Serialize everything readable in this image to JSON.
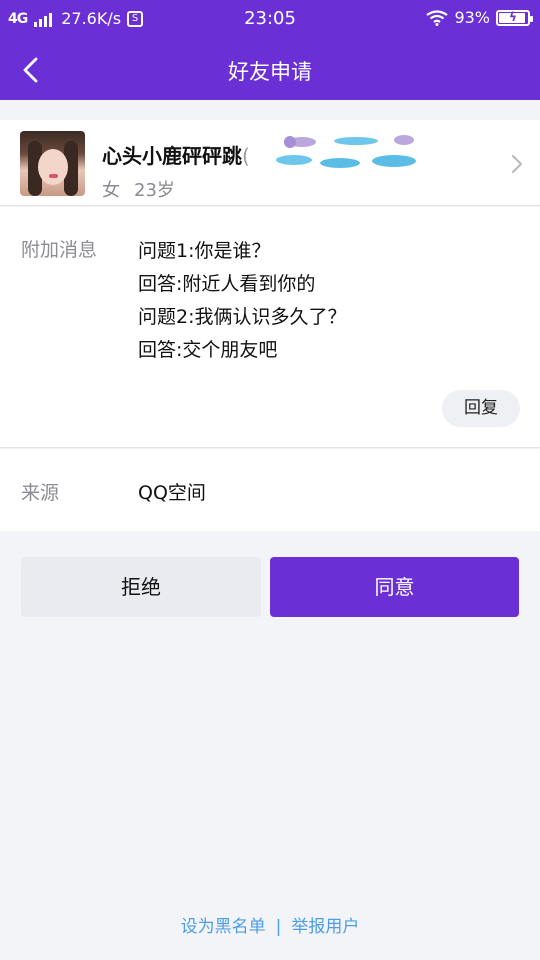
{
  "status_bar": {
    "network": "4G",
    "speed": "27.6K/s",
    "time": "23:05",
    "battery_percent": "93%",
    "battery_level": 0.93
  },
  "nav": {
    "title": "好友申请"
  },
  "profile": {
    "nickname": "心头小鹿砰砰跳",
    "paren": "(",
    "gender": "女",
    "age": "23岁"
  },
  "message": {
    "label": "附加消息",
    "lines": [
      "问题1:你是谁？",
      "回答:附近人看到你的",
      "问题2:我俩认识多久了？",
      "回答:交个朋友吧"
    ],
    "reply_label": "回复"
  },
  "source": {
    "label": "来源",
    "value": "QQ空间"
  },
  "actions": {
    "reject_label": "拒绝",
    "accept_label": "同意"
  },
  "footer": {
    "blacklist_label": "设为黑名单",
    "separator": "|",
    "report_label": "举报用户"
  },
  "colors": {
    "brand": "#6a30d6",
    "link": "#4d9de6"
  }
}
